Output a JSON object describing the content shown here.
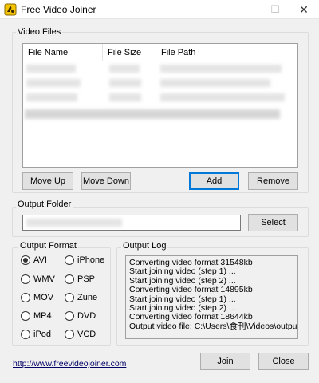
{
  "window": {
    "title": "Free Video Joiner",
    "minimize_glyph": "—",
    "maximize_glyph": "☐",
    "close_glyph": "✕"
  },
  "icons": {
    "app": "video-joiner-app-icon"
  },
  "video_files": {
    "group_label": "Video Files",
    "columns": [
      "File Name",
      "File Size",
      "File Path"
    ],
    "buttons": {
      "move_up": "Move Up",
      "move_down": "Move Down",
      "add": "Add",
      "remove": "Remove"
    }
  },
  "output_folder": {
    "group_label": "Output Folder",
    "select_button": "Select"
  },
  "output_format": {
    "group_label": "Output Format",
    "selected": "AVI",
    "options": [
      "AVI",
      "iPhone",
      "WMV",
      "PSP",
      "MOV",
      "Zune",
      "MP4",
      "DVD",
      "iPod",
      "VCD"
    ]
  },
  "output_log": {
    "group_label": "Output Log",
    "lines": [
      "Converting video format 31548kb",
      "Start joining video (step 1) ...",
      "Start joining video (step 2) ...",
      "Converting video format 14895kb",
      "Start joining video (step 1) ...",
      "Start joining video (step 2) ...",
      "Converting video format 18644kb",
      "Output video file: C:\\Users\\食刊\\Videos\\output.avi"
    ]
  },
  "footer": {
    "link": "http://www.freevideojoiner.com",
    "join_button": "Join",
    "close_button": "Close"
  }
}
